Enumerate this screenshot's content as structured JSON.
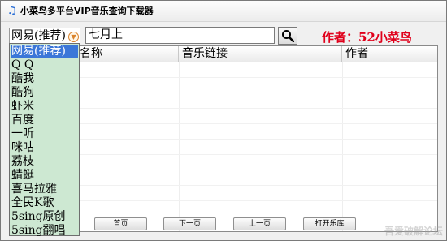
{
  "window": {
    "title": "小菜鸟多平台VIP音乐查询下载器",
    "app_icon": "music-note-icon"
  },
  "search": {
    "source_selected": "网易(推荐)",
    "query": "七月上",
    "author_label": "作者：52小菜鸟"
  },
  "table": {
    "columns": [
      "名称",
      "音乐链接",
      "作者"
    ]
  },
  "dropdown": {
    "options": [
      "网易(推荐)",
      "Q Q",
      "酷我",
      "酷狗",
      "虾米",
      "百度",
      "一听",
      "咪咕",
      "荔枝",
      "蜻蜓",
      "喜马拉雅",
      "全民K歌",
      "5sing原创",
      "5sing翻唱"
    ]
  },
  "buttons": {
    "first_page": "首页",
    "next_page": "下一页",
    "prev_page": "上一页",
    "open_library": "打开乐库"
  },
  "watermark": "吾爱破解论坛"
}
